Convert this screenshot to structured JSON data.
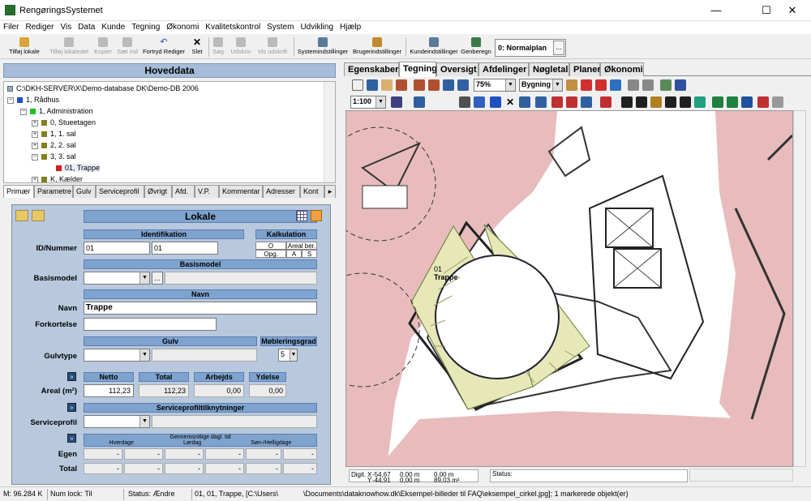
{
  "window": {
    "title": "RengøringsSystemet",
    "minimize": "—",
    "maximize": "☐",
    "close": "✕"
  },
  "menu": [
    "Filer",
    "Rediger",
    "Vis",
    "Data",
    "Kunde",
    "Tegning",
    "Økonomi",
    "Kvalitetskontrol",
    "System",
    "Udvikling",
    "Hjælp"
  ],
  "toolbar": {
    "tilfoej_lokale": "Tilføj lokale",
    "tilfoej_lokaledel": "Tilføj lokaledel",
    "kopier": "Kopier",
    "saet_ind": "Sæt ind",
    "fortryd": "Fortryd Rediger",
    "slet": "Slet",
    "soeg": "Søg",
    "udskriv": "Udskriv",
    "vis_udskrift": "Vis udskrift",
    "systemindstillinger": "Systemindstillinger",
    "brugerindstillinger": "Brugerindstillinger",
    "kundeindstillinger": "Kundeindstillinger",
    "genberegn": "Genberegn",
    "plan": "0: Normalplan",
    "plan_btn": "..."
  },
  "hoveddata": "Hoveddata",
  "tree": [
    {
      "label": "C:\\DKH-SERVER\\X\\Demo-database DK\\Demo-DB 2006",
      "color": "#ffffff"
    },
    {
      "label": "1, Rådhus",
      "color": "#2050c0"
    },
    {
      "label": "1, Administration",
      "color": "#20c020"
    },
    {
      "label": "0, Stueetagen",
      "color": "#808020"
    },
    {
      "label": "1, 1. sal",
      "color": "#808020"
    },
    {
      "label": "2, 2. sal",
      "color": "#808020"
    },
    {
      "label": "3, 3. sal",
      "color": "#808020"
    },
    {
      "label": "01, Trappe",
      "color": "#d02020"
    },
    {
      "label": "K, Kælder",
      "color": "#808020"
    }
  ],
  "left_tabs": [
    "Primær",
    "Parametre",
    "Gulv",
    "Serviceprofil",
    "Øvrigt",
    "Afd.",
    "V.P.",
    "Kommentar",
    "Adresser",
    "Kont"
  ],
  "form": {
    "title": "Lokale",
    "identifikation": "Identifikation",
    "kalkulation": "Kalkulation",
    "kalk_o": "O",
    "kalk_areal": "Areal ber.",
    "kalk_opg": "Opg.",
    "kalk_a": "A",
    "kalk_s": "S",
    "id_label": "ID/Nummer",
    "id1": "01",
    "id2": "01",
    "basismodel_hdr": "Basismodel",
    "basismodel_label": "Basismodel",
    "basismodel_btn": "...",
    "navn_hdr": "Navn",
    "navn_label": "Navn",
    "navn_value": "Trappe",
    "forkortelse_label": "Forkortelse",
    "gulv_hdr": "Gulv",
    "moeb_hdr": "Møbleringsgrad",
    "gulvtype_label": "Gulvtype",
    "moeb_value": "5",
    "netto_hdr": "Netto",
    "total_hdr": "Total",
    "arbejds_hdr": "Arbejds",
    "ydelse_hdr": "Ydelse",
    "areal_label": "Areal (m²)",
    "netto": "112,23",
    "total": "112,23",
    "arbejds": "0,00",
    "ydelse": "0,00",
    "sp_hdr": "Serviceprofiltilknytninger",
    "sp_label": "Serviceprofil",
    "gennemsnit_hdr": "Gennemsnitlige dagl. tid",
    "hverdage": "Hverdage",
    "loerdag": "Lørdag",
    "soen": "Søn-/Helligdage",
    "egen_label": "Egen",
    "total_label": "Total",
    "dash": "-",
    "expand": "»"
  },
  "right_tabs": [
    "Egenskaber",
    "Tegning",
    "Oversigt",
    "Afdelinger",
    "Nøgletal",
    "Planer",
    "Økonomi"
  ],
  "drawing_toolbar": {
    "zoom": "75%",
    "layer": "Bygning",
    "scale": "1:100"
  },
  "drawing": {
    "room_id": "01",
    "room_name": "Trappe"
  },
  "coords": {
    "digit_label": "Digit.",
    "x_label": "X",
    "y_label": "Y",
    "x": "-54,67",
    "y": "-44,91",
    "dx": "0,00 m",
    "dy": "0,00 m",
    "dz": "0,00 m",
    "area": "89,03 m²",
    "status_label": "Status:"
  },
  "statusbar": {
    "memory": "M: 96.284 K",
    "numlock": "Num lock: Til",
    "status": "Status: Ændre",
    "path_a": "01, 01, Trappe, [C:\\Users\\",
    "path_b": "\\Documents\\dataknowhow.dk\\Eksempel-billeder til FAQ\\eksempel_cirkel.jpg]; 1 markerede objekt(er)"
  }
}
